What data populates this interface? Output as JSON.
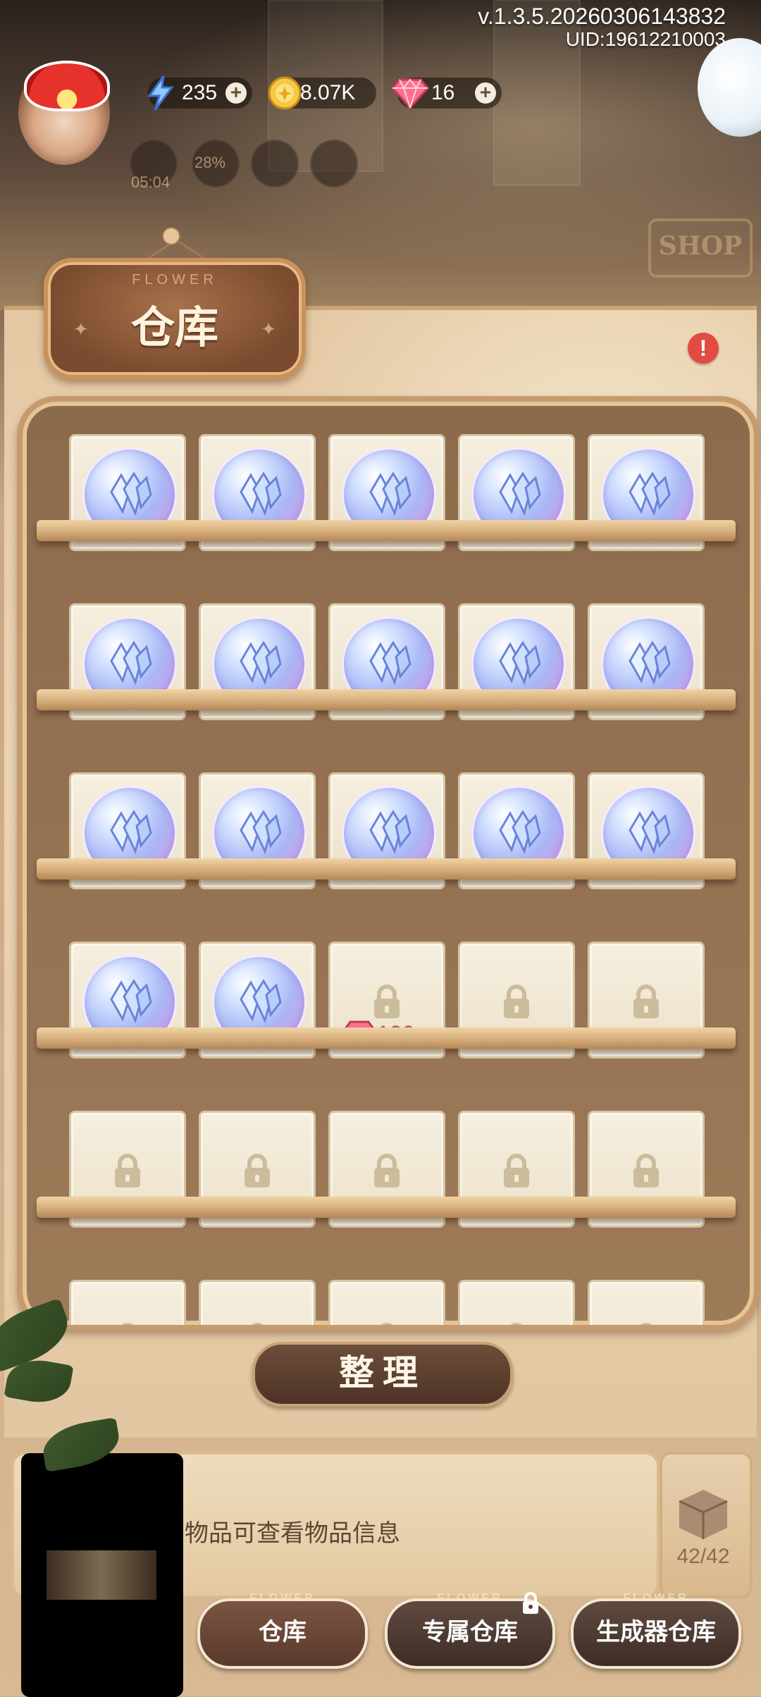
{
  "header": {
    "version": "v.1.3.5.20260306143832",
    "uid": "UID:19612210003"
  },
  "resources": {
    "energy": {
      "value": "235",
      "icon": "lightning-icon"
    },
    "coins": {
      "value": "8.07K",
      "icon": "coin-icon"
    },
    "gems": {
      "value": "16",
      "icon": "gem-icon"
    }
  },
  "status": {
    "timer": "05:04",
    "percent": "28%"
  },
  "shop_sign": "SHOP",
  "panel": {
    "title_sub": "FLOWER",
    "title": "仓库",
    "alert": "!"
  },
  "inventory": {
    "crystal_item_count": 17,
    "locked_slot_price": "100"
  },
  "sort_button": "整理",
  "info": {
    "text": "物品可查看物品信息",
    "capacity": "42/42"
  },
  "tabs": [
    {
      "label": "仓库",
      "flower": "FLOWER",
      "active": true
    },
    {
      "label": "专属仓库",
      "flower": "FLOWER",
      "locked": true
    },
    {
      "label": "生成器仓库",
      "flower": "FLOWER"
    }
  ],
  "colors": {
    "accent_brown": "#5a3a2c",
    "alert_red": "#e24a42",
    "price_text": "#b56148"
  }
}
